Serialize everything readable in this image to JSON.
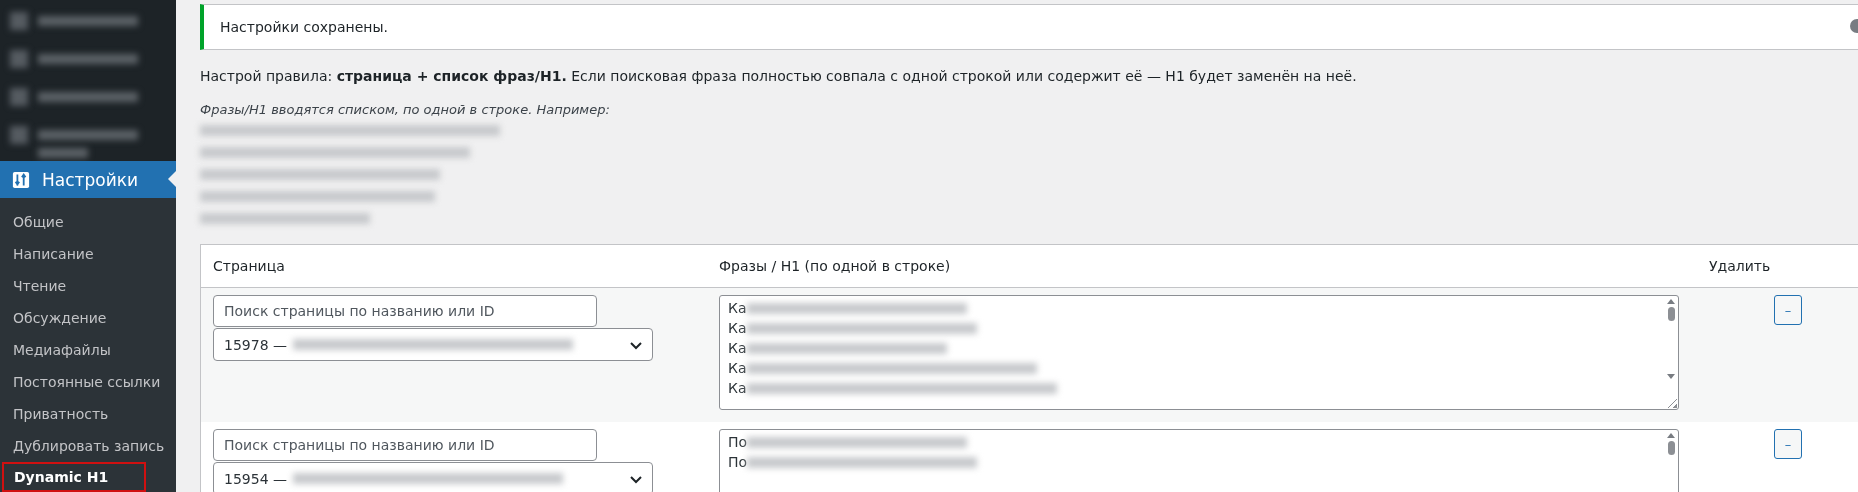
{
  "sidebar": {
    "section": {
      "label": "Настройки",
      "selected": true
    },
    "items": [
      {
        "label": "Общие",
        "selected": false,
        "highlighted": false
      },
      {
        "label": "Написание",
        "selected": false,
        "highlighted": false
      },
      {
        "label": "Чтение",
        "selected": false,
        "highlighted": false
      },
      {
        "label": "Обсуждение",
        "selected": false,
        "highlighted": false
      },
      {
        "label": "Медиафайлы",
        "selected": false,
        "highlighted": false
      },
      {
        "label": "Постоянные ссылки",
        "selected": false,
        "highlighted": false
      },
      {
        "label": "Приватность",
        "selected": false,
        "highlighted": false
      },
      {
        "label": "Дублировать запись",
        "selected": false,
        "highlighted": false
      },
      {
        "label": "Dynamic H1",
        "selected": true,
        "highlighted": true
      }
    ]
  },
  "notice": {
    "text": "Настройки сохранены."
  },
  "description": "Настрой правила: **страница + список фраз/H1.** Если поисковая фраза полностью совпала с одной строкой или содержит её — H1 будет заменён на неё.",
  "example_intro": "Фразы/H1 вводятся списком, по одной в строке. Например:",
  "table": {
    "columns": [
      "Страница",
      "Фразы / H1 (по одной в строке)",
      "Удалить"
    ],
    "rows": [
      {
        "search_placeholder": "Поиск страницы по названию или ID",
        "page": "15978 —",
        "phrases": [
          "Ка",
          "Ка",
          "Ка",
          "Ка",
          "Ка"
        ],
        "remove": "–"
      },
      {
        "search_placeholder": "Поиск страницы по названию или ID",
        "page": "15954 —",
        "phrases": [
          "По",
          "По"
        ],
        "remove": "–"
      }
    ]
  }
}
